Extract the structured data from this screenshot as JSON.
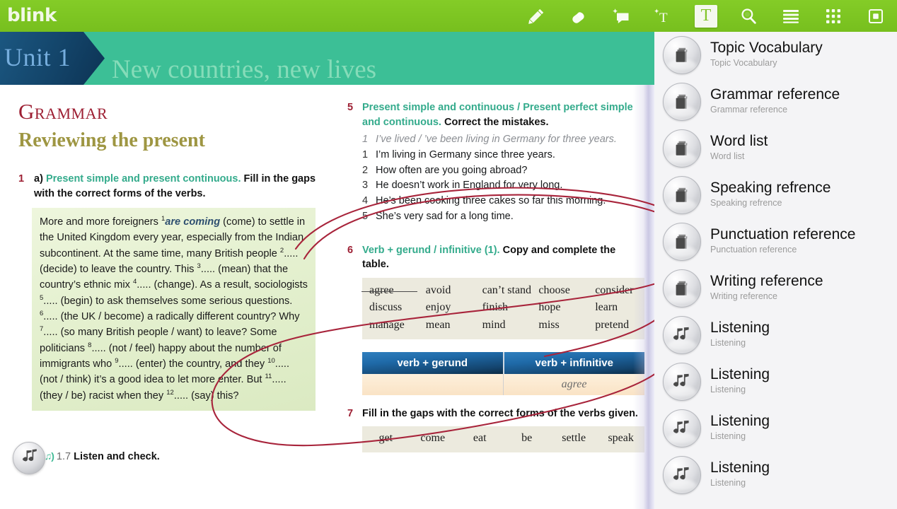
{
  "app": {
    "logo": "blink"
  },
  "toolbar": {
    "tools": [
      {
        "name": "pen-icon",
        "label": "Pen",
        "active": false
      },
      {
        "name": "eraser-icon",
        "label": "Eraser",
        "active": false
      },
      {
        "name": "add-note-icon",
        "label": "Add note",
        "active": false
      },
      {
        "name": "add-text-icon",
        "label": "Add text",
        "active": false
      },
      {
        "name": "text-tool-icon",
        "label": "T",
        "active": true
      },
      {
        "name": "search-icon",
        "label": "Search",
        "active": false
      },
      {
        "name": "list-icon",
        "label": "Contents",
        "active": false
      },
      {
        "name": "grid-icon",
        "label": "Thumbnails",
        "active": false
      },
      {
        "name": "bookmark-icon",
        "label": "Bookmark",
        "active": false
      }
    ]
  },
  "banner": {
    "unit": "Unit 1",
    "title": "New countries, new lives"
  },
  "page": {
    "heading": "Grammar",
    "subheading": "Reviewing the present",
    "exercise1": {
      "number": "1",
      "part": "a)",
      "topic": "Present simple and present continuous.",
      "instruction": "Fill in the gaps with the correct forms of the verbs.",
      "passage_html": "More and more foreigners <sup>1</sup><i>are coming</i> (come) to settle in the United Kingdom every year, especially from the Indian subcontinent. At the same time, many British people <sup>2</sup>..... (decide) to leave the country. This <sup>3</sup>..... (mean) that the country&rsquo;s ethnic mix <sup>4</sup>..... (change). As a result, sociologists <sup>5</sup>..... (begin) to ask themselves some serious questions. <sup>6</sup>..... (the UK / become) a radically different country? Why <sup>7</sup>..... (so many British people / want) to leave? Some politicians <sup>8</sup>..... (not / feel) happy about the number of immigrants who <sup>9</sup>..... (enter) the country, and they <sup>10</sup>..... (not / think) it&rsquo;s a good idea to let more enter. But <sup>11</sup>..... (they / be) racist when they <sup>12</sup>..... (say) this?",
      "part_b": "b)",
      "track": "1.7",
      "part_b_instruction": "Listen and check."
    },
    "exercise5": {
      "number": "5",
      "topic": "Present simple and continuous / Present perfect simple and continuous.",
      "instruction": "Correct the mistakes.",
      "items": [
        {
          "n": "1",
          "text": "I’ve lived / ’ve been living in Germany for three years.",
          "example": true
        },
        {
          "n": "1",
          "text": "I’m living in Germany since three years.",
          "example": false
        },
        {
          "n": "2",
          "text": "How often are you going abroad?",
          "example": false
        },
        {
          "n": "3",
          "text": "He doesn’t work in England for very long.",
          "example": false
        },
        {
          "n": "4",
          "text": "He’s been cooking three cakes so far this morning.",
          "example": false
        },
        {
          "n": "5",
          "text": "She’s very sad for a long time.",
          "example": false
        }
      ]
    },
    "exercise6": {
      "number": "6",
      "topic": "Verb + gerund / infinitive (1).",
      "instruction": "Copy and complete the table.",
      "words": [
        [
          "agree",
          "avoid",
          "can’t stand",
          "choose",
          "consider"
        ],
        [
          "discuss",
          "enjoy",
          "finish",
          "hope",
          "learn"
        ],
        [
          "manage",
          "mean",
          "mind",
          "miss",
          "pretend"
        ]
      ],
      "struck_word": "agree",
      "table": {
        "headers": [
          "verb + gerund",
          "verb + infinitive"
        ],
        "row": [
          "",
          "agree"
        ]
      }
    },
    "exercise7": {
      "number": "7",
      "instruction": "Fill in the gaps with the correct forms of the verbs given.",
      "words": [
        "get",
        "come",
        "eat",
        "be",
        "settle",
        "speak"
      ]
    },
    "annotation": {
      "name": "red-ink-ellipse",
      "color": "#a8243b"
    }
  },
  "sidebar": {
    "items": [
      {
        "title": "Topic Vocabulary",
        "subtitle": "Topic Vocabulary",
        "icon": "books-stack-icon"
      },
      {
        "title": "Grammar reference",
        "subtitle": "Grammar reference",
        "icon": "books-stack-icon"
      },
      {
        "title": "Word list",
        "subtitle": "Word list",
        "icon": "books-stack-icon"
      },
      {
        "title": "Speaking refrence",
        "subtitle": "Speaking refrence",
        "icon": "books-stack-icon"
      },
      {
        "title": "Punctuation reference",
        "subtitle": "Punctuation reference",
        "icon": "books-stack-icon"
      },
      {
        "title": "Writing reference",
        "subtitle": "Writing reference",
        "icon": "books-stack-icon"
      },
      {
        "title": "Listening",
        "subtitle": "Listening",
        "icon": "music-note-icon"
      },
      {
        "title": "Listening",
        "subtitle": "Listening",
        "icon": "music-note-icon"
      },
      {
        "title": "Listening",
        "subtitle": "Listening",
        "icon": "music-note-icon"
      },
      {
        "title": "Listening",
        "subtitle": "Listening",
        "icon": "music-note-icon"
      }
    ]
  },
  "colors": {
    "toolbar_green": "#7DC623",
    "banner_teal": "#3cbf96",
    "unit_blue": "#154a72",
    "heading_red": "#9d1f33",
    "subheading_olive": "#9e9642",
    "topic_teal": "#34ab8c",
    "ink_red": "#a8243b",
    "highlight_green": "#e4f0cf"
  }
}
